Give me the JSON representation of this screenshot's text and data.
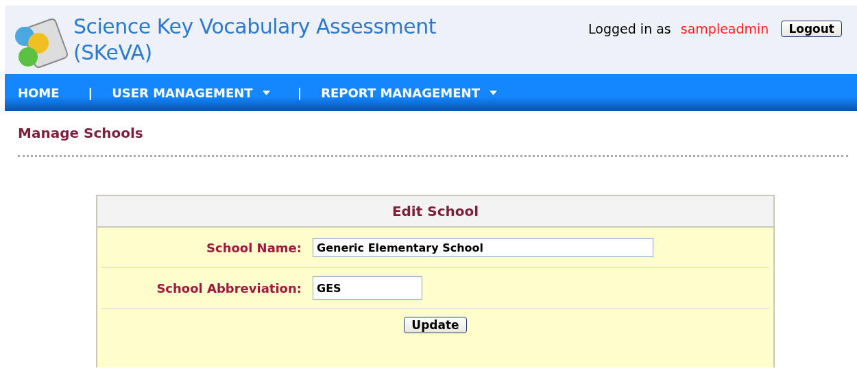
{
  "header": {
    "title": "Science Key Vocabulary Assessment (SKeVA)",
    "logged_in_label": "Logged in as",
    "username": "sampleadmin",
    "logout_button": "Logout"
  },
  "nav": [
    {
      "kind": "link",
      "label": "HOME",
      "dropdown": false
    },
    {
      "kind": "separator",
      "label": "|"
    },
    {
      "kind": "link",
      "label": "USER MANAGEMENT",
      "dropdown": true
    },
    {
      "kind": "separator",
      "label": "|"
    },
    {
      "kind": "link",
      "label": "REPORT MANAGEMENT",
      "dropdown": true
    }
  ],
  "page_title": "Manage Schools",
  "form": {
    "title": "Edit School",
    "fields": [
      {
        "label": "School Name:",
        "value": "Generic Elementary School"
      },
      {
        "label": "School Abbreviation:",
        "value": "GES"
      }
    ],
    "submit_button": "Update"
  }
}
